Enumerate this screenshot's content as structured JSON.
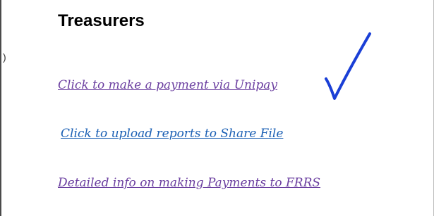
{
  "section": {
    "heading": "Treasurers",
    "clipped_text": ")"
  },
  "links": [
    {
      "label": "Click to make a payment via Unipay",
      "color": "#6b3fa0"
    },
    {
      "label": "Click to upload reports to Share File",
      "color": "#1a5fb4"
    },
    {
      "label": "Detailed info on making Payments to FRRS",
      "color": "#6b3fa0"
    }
  ],
  "annotation": {
    "icon": "checkmark-annotation-icon",
    "color": "#1a3fd6"
  }
}
